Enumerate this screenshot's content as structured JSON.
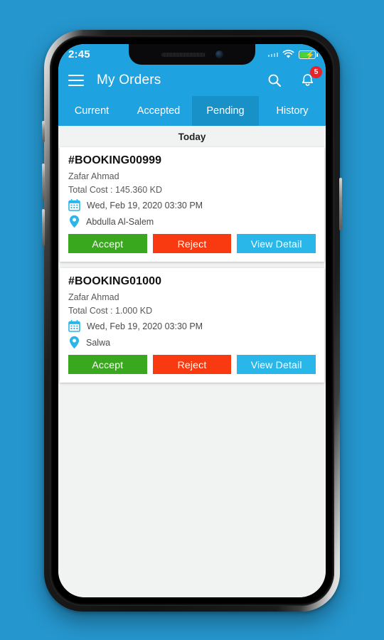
{
  "status_bar": {
    "time": "2:45",
    "wifi_icon": "wifi-icon",
    "battery_icon": "battery-charging-icon",
    "signal_icon": "signal-dots-icon"
  },
  "app_bar": {
    "menu_icon": "hamburger-menu-icon",
    "title": "My Orders",
    "search_icon": "search-icon",
    "notification_icon": "bell-icon",
    "notification_count": "5"
  },
  "tabs": [
    {
      "label": "Current",
      "selected": false
    },
    {
      "label": "Accepted",
      "selected": false
    },
    {
      "label": "Pending",
      "selected": true
    },
    {
      "label": "History",
      "selected": false
    }
  ],
  "day_header": "Today",
  "bookings": [
    {
      "id": "#BOOKING00999",
      "customer": "Zafar Ahmad",
      "cost": "Total Cost : 145.360 KD",
      "datetime": "Wed, Feb 19, 2020 03:30 PM",
      "location": "Abdulla Al-Salem",
      "accept_label": "Accept",
      "reject_label": "Reject",
      "detail_label": "View Detail"
    },
    {
      "id": "#BOOKING01000",
      "customer": "Zafar Ahmad",
      "cost": "Total Cost : 1.000 KD",
      "datetime": "Wed, Feb 19, 2020 03:30 PM",
      "location": "Salwa",
      "accept_label": "Accept",
      "reject_label": "Reject",
      "detail_label": "View Detail"
    }
  ],
  "colors": {
    "primary": "#1fa2e0",
    "tab_selected": "#1890c8",
    "page_background": "#2596ce",
    "accept_green": "#3aa81f",
    "reject_red": "#f93a10",
    "detail_blue": "#29b6e8",
    "badge_red": "#e8232a",
    "battery_green": "#4cd137",
    "content_background": "#f1f2f2"
  }
}
